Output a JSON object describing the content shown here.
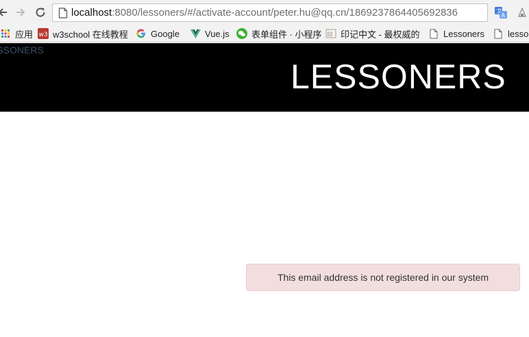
{
  "browser": {
    "url_host": "localhost",
    "url_rest": ":8080/lessoners/#/activate-account/peter.hu@qq.cn/1869237864405692836"
  },
  "bookmarks": [
    {
      "label": "应用",
      "icon": "apps-grid-icon"
    },
    {
      "label": "w3school 在线教程",
      "icon": "w3school-icon"
    },
    {
      "label": "Google",
      "icon": "google-icon"
    },
    {
      "label": "Vue.js",
      "icon": "vue-icon"
    },
    {
      "label": "表单组件 · 小程序",
      "icon": "wechat-icon"
    },
    {
      "label": "印记中文 - 最权威的",
      "icon": "yinji-icon"
    },
    {
      "label": "Lessoners",
      "icon": "page-icon"
    },
    {
      "label": "lesso",
      "icon": "page-icon"
    }
  ],
  "page": {
    "small_brand": "ESSONERS",
    "brand": "LESSONERS",
    "alert_message": "This email address is not registered in our system"
  },
  "colors": {
    "header_bg": "#000000",
    "alert_bg": "#f2dede",
    "alert_border": "#ebccd1"
  }
}
